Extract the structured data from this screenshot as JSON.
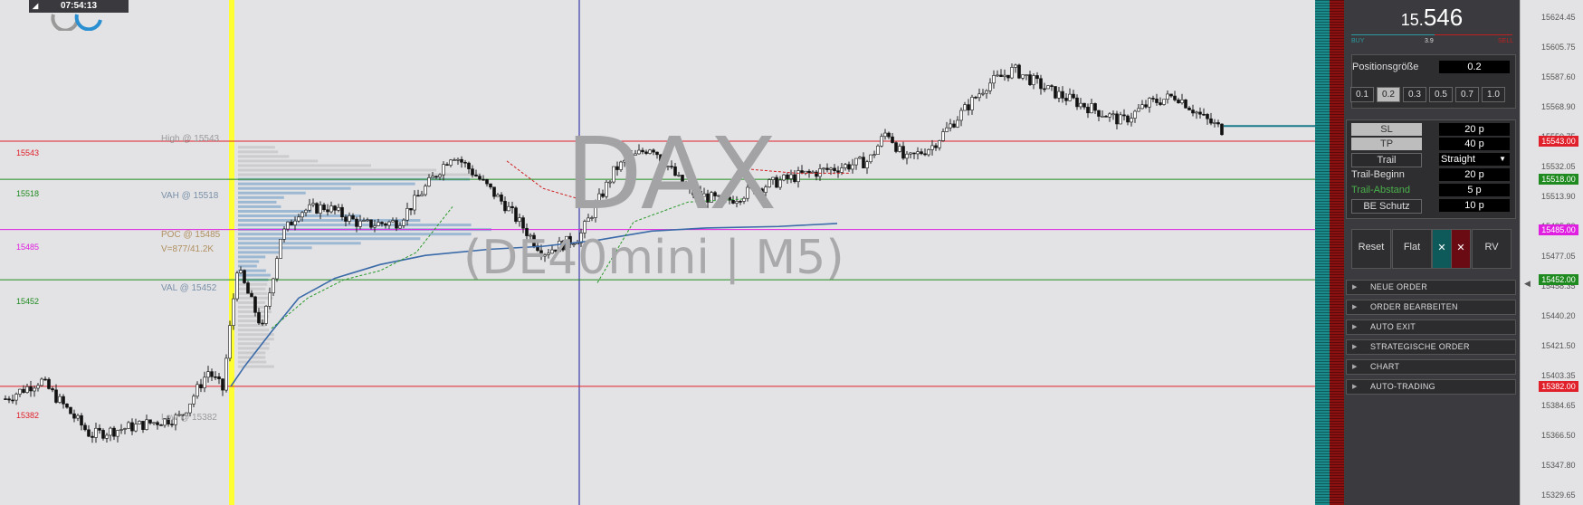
{
  "clock": {
    "time": "07:54:13"
  },
  "watermark": {
    "symbol": "DAX",
    "sub": "(DE40mini | M5)"
  },
  "volume_profile": {
    "high_label": "High @ 15543",
    "vah_label": "VAH @ 15518",
    "poc_label": "POC @ 15485",
    "vol_label": "V=877/41.2K",
    "val_label": "VAL @ 15452",
    "low_label": "Low @ 15382"
  },
  "levels": [
    {
      "value": "15543",
      "price": 15543,
      "color": "#e0202a"
    },
    {
      "value": "15518",
      "price": 15518,
      "color": "#1f8a1f"
    },
    {
      "value": "15485",
      "price": 15485,
      "color": "#e020e0"
    },
    {
      "value": "15452",
      "price": 15452,
      "color": "#1f8a1f"
    },
    {
      "value": "15382",
      "price": 15382,
      "color": "#e0202a"
    }
  ],
  "panel": {
    "price_small": "15.",
    "price_big": "546",
    "buy_label": "BUY",
    "spread": "3.9",
    "sell_label": "SELL",
    "position_size_label": "Positionsgröße",
    "position_size_value": "0.2",
    "sizes": [
      "0.1",
      "0.2",
      "0.3",
      "0.5",
      "0.7",
      "1.0"
    ],
    "selected_size": "0.2",
    "sl_label": "SL",
    "sl_value": "20 p",
    "tp_label": "TP",
    "tp_value": "40 p",
    "trail_label": "Trail",
    "trail_mode": "Straight",
    "trail_begin_label": "Trail-Beginn",
    "trail_begin_value": "20 p",
    "trail_dist_label": "Trail-Abstand",
    "trail_dist_value": "5 p",
    "be_label": "BE Schutz",
    "be_value": "10 p",
    "reset_label": "Reset",
    "flat_label": "Flat",
    "x1_label": "✕",
    "x2_label": "✕",
    "rv_label": "RV",
    "accordions": [
      "NEUE ORDER",
      "ORDER BEARBEITEN",
      "AUTO EXIT",
      "STRATEGISCHE ORDER",
      "CHART",
      "AUTO-TRADING"
    ]
  },
  "axis": {
    "ticks": [
      "15624.45",
      "15605.75",
      "15587.60",
      "15568.90",
      "15550.75",
      "15532.05",
      "15513.90",
      "15495.20",
      "15477.05",
      "15458.35",
      "15440.20",
      "15421.50",
      "15403.35",
      "15384.65",
      "15366.50",
      "15347.80",
      "15329.65"
    ],
    "price_tags": [
      {
        "label": "15543.00",
        "price": 15543,
        "color": "#e0202a"
      },
      {
        "label": "15518.00",
        "price": 15518,
        "color": "#1f8a1f"
      },
      {
        "label": "15485.00",
        "price": 15485,
        "color": "#e020e0"
      },
      {
        "label": "15452.00",
        "price": 15452,
        "color": "#1f8a1f"
      },
      {
        "label": "15382.00",
        "price": 15382,
        "color": "#e0202a"
      }
    ]
  },
  "colors": {
    "yellow_marker": "#ffff33",
    "blue_marker": "#1a1aa0",
    "vwap": "#3a6aa8"
  }
}
